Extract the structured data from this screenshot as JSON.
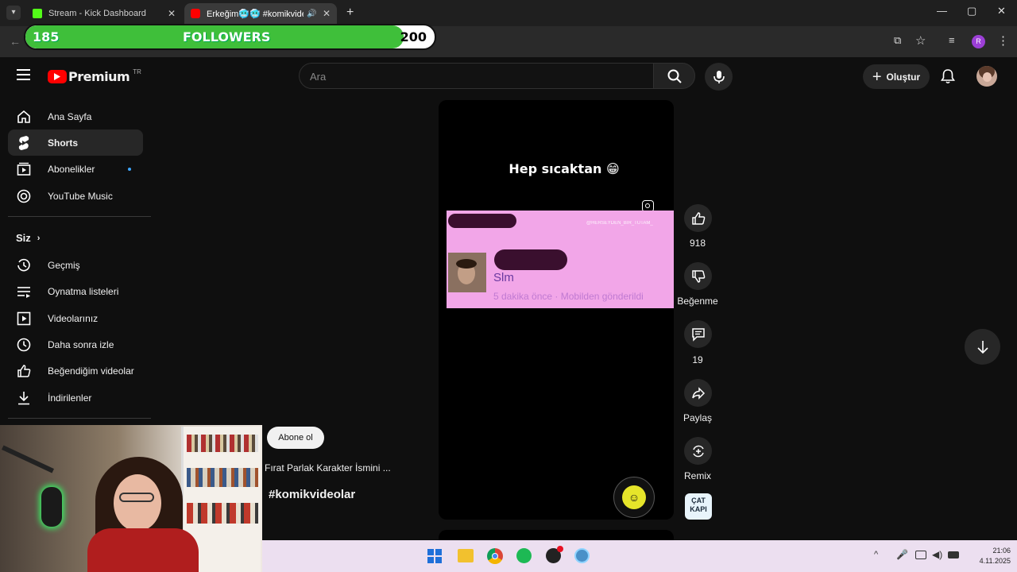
{
  "browser": {
    "tabs": [
      {
        "title": "Stream - Kick Dashboard",
        "color": "#53fc18"
      },
      {
        "title": "Erkeğim🥶🥶 #komikvide",
        "color": "#ff0000"
      }
    ]
  },
  "followers": {
    "current": "185",
    "label": "FOLLOWERS",
    "goal": "200",
    "progress": 0.925
  },
  "youtube": {
    "logo_text": "Premium",
    "region": "TR",
    "search_placeholder": "Ara",
    "create_label": "Oluştur"
  },
  "sidebar": {
    "items": [
      {
        "label": "Ana Sayfa",
        "icon": "home-icon"
      },
      {
        "label": "Shorts",
        "icon": "shorts-icon"
      },
      {
        "label": "Abonelikler",
        "icon": "subscriptions-icon"
      },
      {
        "label": "YouTube Music",
        "icon": "music-icon"
      }
    ],
    "you_section": "Siz",
    "you_items": [
      {
        "label": "Geçmiş",
        "icon": "history-icon"
      },
      {
        "label": "Oynatma listeleri",
        "icon": "playlist-icon"
      },
      {
        "label": "Videolarınız",
        "icon": "your-videos-icon"
      },
      {
        "label": "Daha sonra izle",
        "icon": "watch-later-icon"
      },
      {
        "label": "Beğendiğim videolar",
        "icon": "liked-icon"
      },
      {
        "label": "İndirilenler",
        "icon": "download-icon"
      }
    ]
  },
  "short": {
    "caption": "Hep sıcaktan 😁",
    "card_handle": "@HERSEYDEN_BIR_TUTAM_",
    "card_name": "Slm",
    "card_meta": "5 dakika önce · Mobilden gönderildi",
    "subscribe_label": "Abone ol",
    "channel_title": "Fırat Parlak Karakter İsmini ...",
    "hashtag": "#komikvideolar",
    "actions": {
      "like_count": "918",
      "dislike_label": "Beğenme",
      "comment_count": "19",
      "share_label": "Paylaş",
      "remix_label": "Remix",
      "audio_thumb_text": "ÇAT KAPI"
    }
  },
  "taskbar": {
    "time": "21:06",
    "date": "4.11.2025"
  }
}
